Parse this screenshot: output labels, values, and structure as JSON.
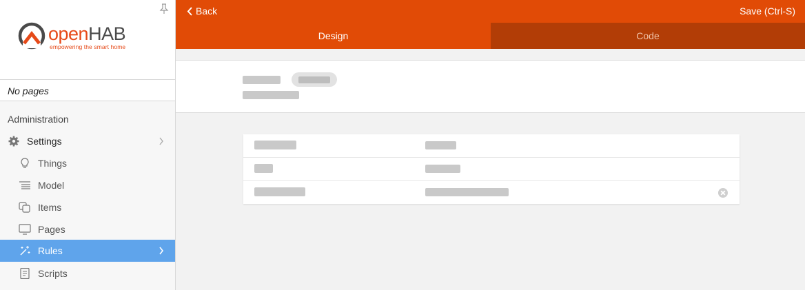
{
  "sidebar": {
    "logo": {
      "brand_open": "open",
      "brand_hab": "HAB",
      "tagline": "empowering the smart home"
    },
    "no_pages": "No pages",
    "admin_title": "Administration",
    "items": [
      {
        "label": "Settings",
        "icon": "gear-icon"
      },
      {
        "label": "Things",
        "icon": "lightbulb-icon"
      },
      {
        "label": "Model",
        "icon": "list-tree-icon"
      },
      {
        "label": "Items",
        "icon": "squares-icon"
      },
      {
        "label": "Pages",
        "icon": "monitor-icon"
      },
      {
        "label": "Rules",
        "icon": "magic-wand-icon"
      },
      {
        "label": "Scripts",
        "icon": "document-icon"
      }
    ]
  },
  "header": {
    "back_label": "Back",
    "save_label": "Save (Ctrl-S)",
    "tabs": [
      {
        "label": "Design"
      },
      {
        "label": "Code"
      }
    ]
  },
  "colors": {
    "header": "#e14b06",
    "code_tab": "#b23d06",
    "active_nav": "#5fa4eb",
    "brand": "#e64a19"
  }
}
